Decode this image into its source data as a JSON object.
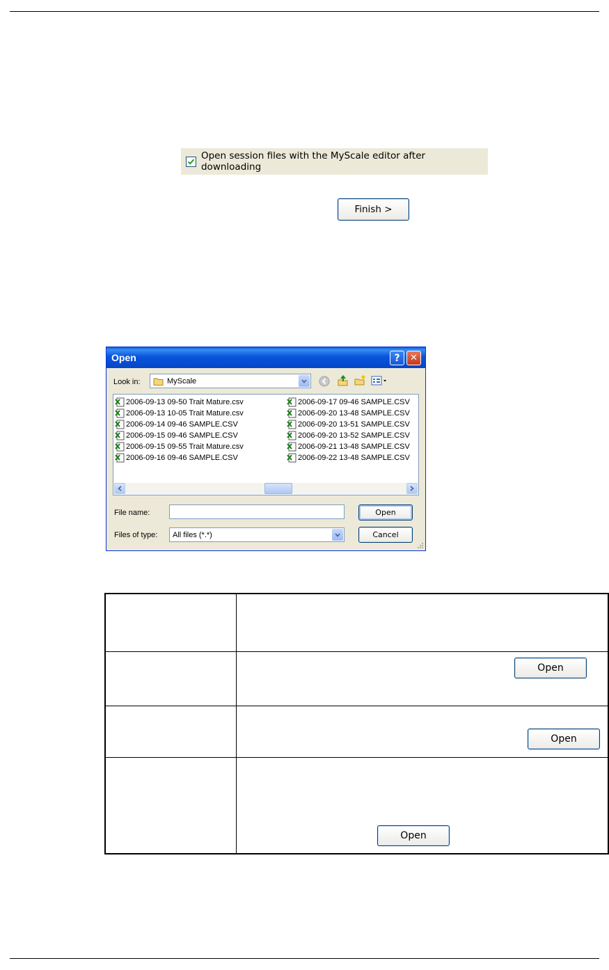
{
  "checkbox": {
    "label": "Open session files with the MyScale editor after downloading",
    "checked": true
  },
  "finish_button": {
    "label": "Finish >"
  },
  "dialog": {
    "title": "Open",
    "help_btn": "?",
    "close_btn": "✕",
    "look_in_label": "Look in:",
    "look_in_value": "MyScale",
    "files_col1": [
      "2006-09-13 09-50 Trait Mature.csv",
      "2006-09-13 10-05 Trait Mature.csv",
      "2006-09-14 09-46 SAMPLE.CSV",
      "2006-09-15 09-46 SAMPLE.CSV",
      "2006-09-15 09-55 Trait Mature.csv",
      "2006-09-16 09-46 SAMPLE.CSV"
    ],
    "files_col2": [
      "2006-09-17 09-46 SAMPLE.CSV",
      "2006-09-20 13-48 SAMPLE.CSV",
      "2006-09-20 13-51 SAMPLE.CSV",
      "2006-09-20 13-52 SAMPLE.CSV",
      "2006-09-21 13-48 SAMPLE.CSV",
      "2006-09-22 13-48 SAMPLE.CSV"
    ],
    "file_name_label": "File name:",
    "file_name_value": "",
    "files_of_type_label": "Files of type:",
    "files_of_type_value": "All files (*.*)",
    "open_btn": "Open",
    "cancel_btn": "Cancel"
  },
  "table": {
    "open_btn_label": "Open"
  }
}
